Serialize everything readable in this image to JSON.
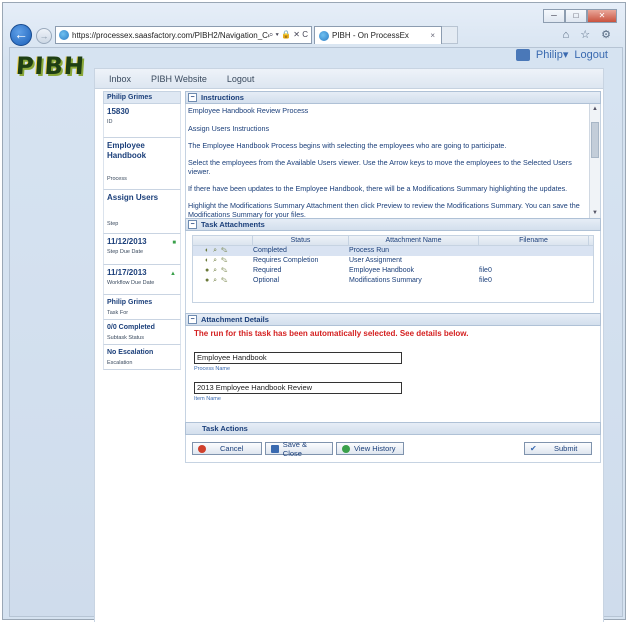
{
  "browser": {
    "url": "https://processex.saasfactory.com/PIBH2/Navigation_Co",
    "tab_title": "PIBH - On ProcessEx",
    "tab_close": "×",
    "url_controls": "⌕ ▾ 🔒 ✕ C",
    "min_label": "─",
    "max_label": "□",
    "close_label": "✕",
    "tools": "⌂ ☆ ⚙"
  },
  "header": {
    "logo": "PIBH",
    "user": "Philip",
    "user_caret": "▾",
    "logout": "Logout"
  },
  "nav": [
    "Inbox",
    "PIBH Website",
    "Logout"
  ],
  "left_panel": {
    "header": "Philip Grimes",
    "blocks": [
      {
        "value": "15830",
        "label": "ID"
      },
      {
        "value": "Employee Handbook",
        "label": "Process"
      },
      {
        "value": "Assign Users",
        "label": "Step"
      },
      {
        "value": "11/12/2013",
        "label": "Step Due Date",
        "indicator": "■"
      },
      {
        "value": "11/17/2013",
        "label": "Workflow Due Date",
        "indicator": "▲"
      },
      {
        "value": "Philip Grimes",
        "label": "Task For"
      },
      {
        "value": "0/0 Completed",
        "label": "Subtask Status"
      },
      {
        "value": "No Escalation",
        "label": "Escalation"
      }
    ]
  },
  "instructions": {
    "title": "Instructions",
    "toggle": "−",
    "paragraphs": [
      "Employee Handbook Review Process",
      "Assign Users Instructions",
      "The Employee Handbook Process begins with selecting the employees who are going to participate.",
      "Select the employees from the Available Users viewer.  Use the Arrow keys to move the employees to the Selected Users viewer.",
      "If there have been updates to the Employee Handbook, there will be a Modifications Summary highlighting the updates.",
      "Highlight the Modifications Summary Attachment then click Preview to review the Modifications Summary.  You can save the Modifications Summary for your files."
    ],
    "scroll_up": "▲",
    "scroll_down": "▼"
  },
  "attachments": {
    "title": "Task Attachments",
    "toggle": "−",
    "columns": [
      "",
      "Status",
      "Attachment Name",
      "Filename"
    ],
    "rows": [
      {
        "icons": "◐ ⌕ ✎",
        "status": "Completed",
        "name": "Process Run",
        "file": "",
        "selected": true
      },
      {
        "icons": "◐ ⌕ ✎",
        "status": "Requires Completion",
        "name": "User Assignment",
        "file": "",
        "selected": false
      },
      {
        "icons": "● ⌕ ✎",
        "status": "Required",
        "name": "Employee Handbook",
        "file": "file0",
        "selected": false
      },
      {
        "icons": "● ⌕ ✎",
        "status": "Optional",
        "name": "Modifications Summary",
        "file": "file0",
        "selected": false
      }
    ]
  },
  "details": {
    "title": "Attachment Details",
    "toggle": "−",
    "message": "The run for this task has been automatically selected. See details below.",
    "process_name_value": "Employee Handbook",
    "process_name_label": "Process Name",
    "item_name_value": "2013 Employee Handbook Review",
    "item_name_label": "Item Name"
  },
  "actions": {
    "title": "Task Actions",
    "cancel": "Cancel",
    "save_close": "Save & Close",
    "view_history": "View History",
    "submit": "Submit",
    "submit_icon": "✔"
  }
}
